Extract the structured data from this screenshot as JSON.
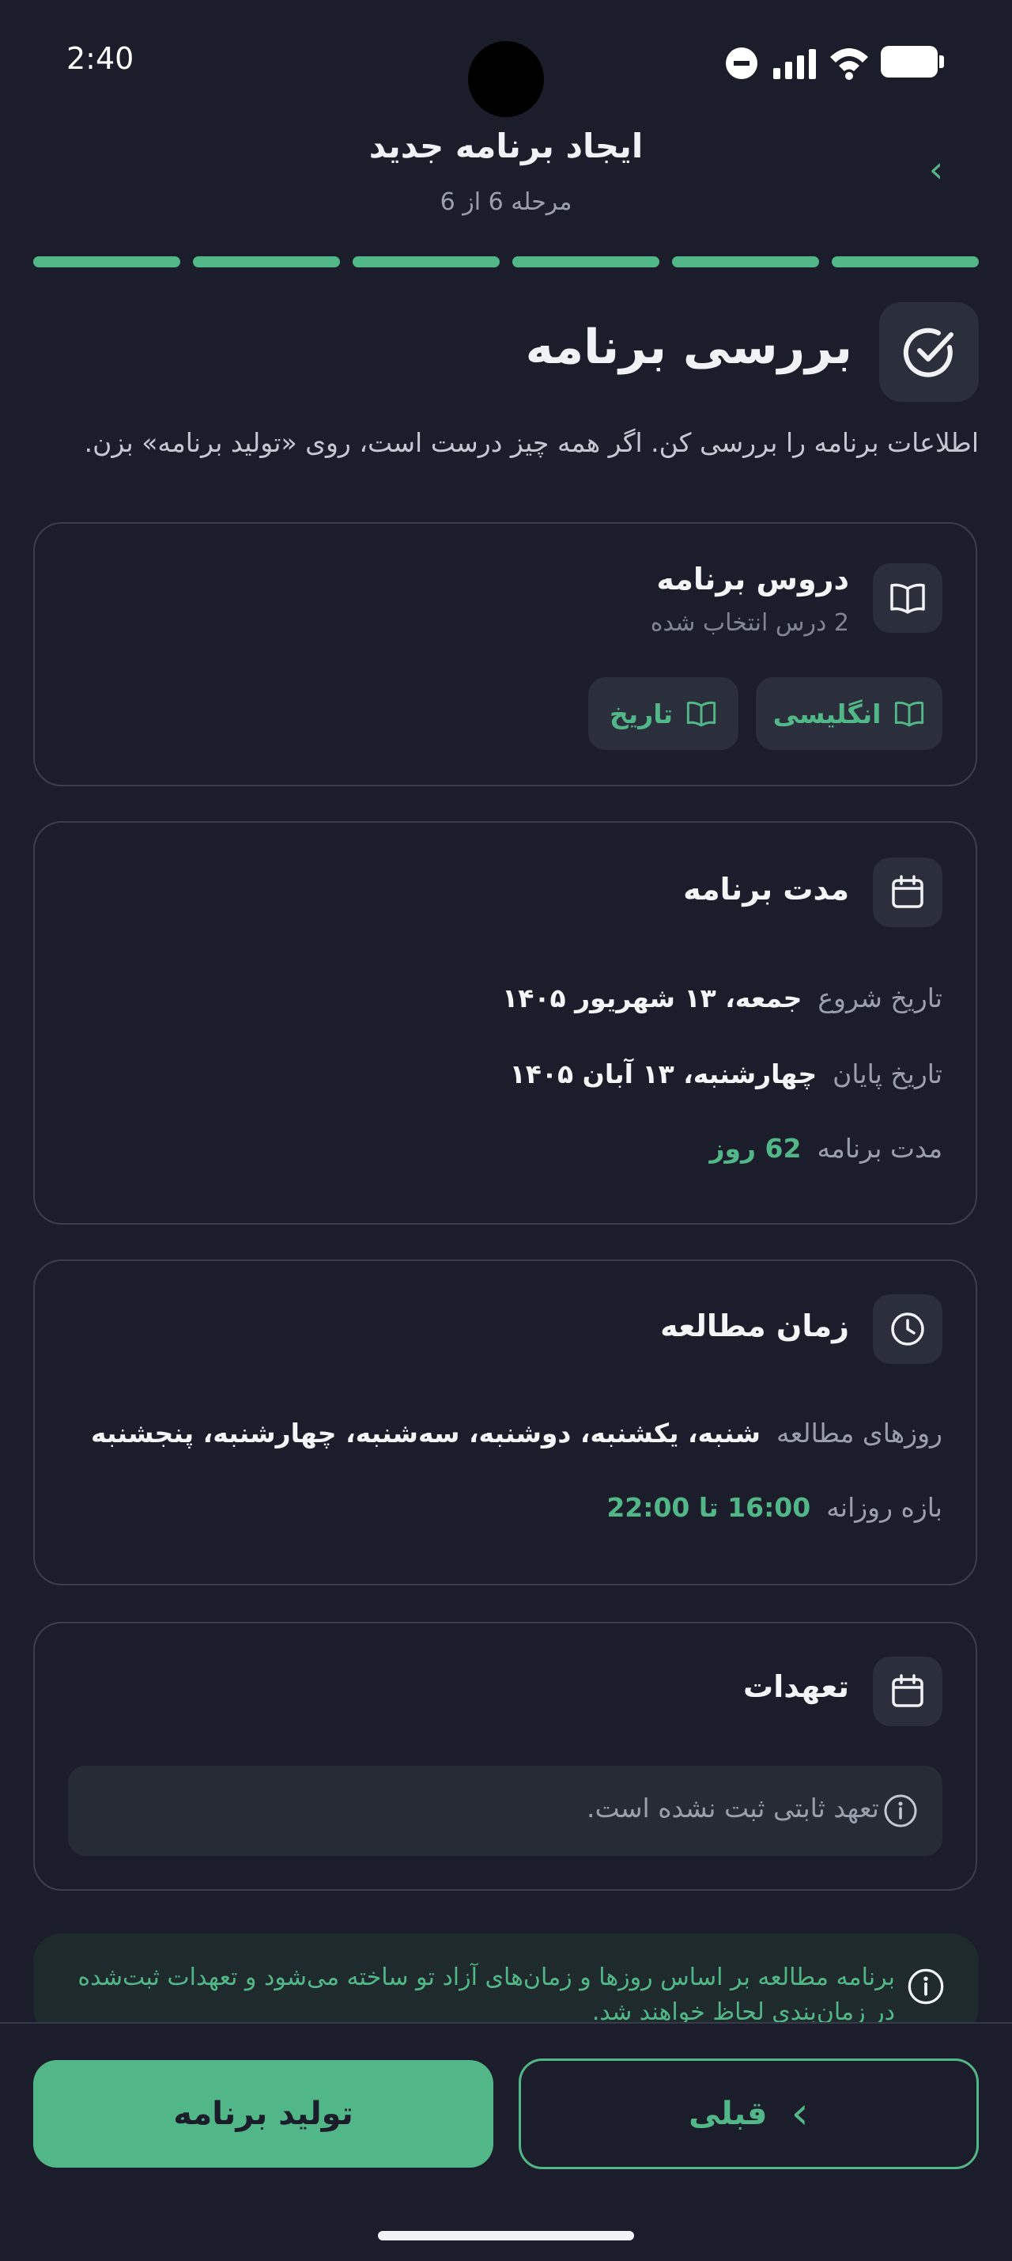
{
  "status_bar": {
    "time": "2:40"
  },
  "header": {
    "title": "ایجاد برنامه جدید",
    "step": "مرحله 6 از 6"
  },
  "progress": {
    "current_step": 6,
    "total_steps": 6
  },
  "intro": {
    "title": "بررسی برنامه",
    "description": "اطلاعات برنامه را بررسی کن. اگر همه چیز درست است، روی «تولید برنامه» بزن."
  },
  "lessons_card": {
    "title": "دروس برنامه",
    "subtitle": "2 درس انتخاب شده",
    "chips": [
      "انگلیسی",
      "تاریخ"
    ]
  },
  "duration_card": {
    "title": "مدت برنامه",
    "start_label": "تاریخ شروع",
    "start_value": "جمعه، ۱۳ شهریور ۱۴۰۵",
    "end_label": "تاریخ پایان",
    "end_value": "چهارشنبه، ۱۳ آبان ۱۴۰۵",
    "length_label": "مدت برنامه",
    "length_value": "62 روز"
  },
  "study_card": {
    "title": "زمان مطالعه",
    "days_label": "روزهای مطالعه",
    "days_value": "شنبه، یکشنبه، دوشنبه، سه‌شنبه، چهارشنبه، پنجشنبه",
    "range_label": "بازه روزانه",
    "range_value": "16:00 تا 22:00"
  },
  "commitments_card": {
    "title": "تعهدات",
    "empty_text": "تعهد ثابتی ثبت نشده است."
  },
  "note": {
    "line1": "برنامه مطالعه بر اساس روزها و زمان‌های آزاد تو ساخته می‌شود و تعهدات ثبت‌شده",
    "line2": "در زمان‌بندی لحاظ خواهند شد."
  },
  "footer": {
    "generate_label": "تولید برنامه",
    "prev_label": "قبلی"
  },
  "colors": {
    "background": "#1b1e2a",
    "accent": "#52b788",
    "card_border": "#3b3f4d"
  }
}
